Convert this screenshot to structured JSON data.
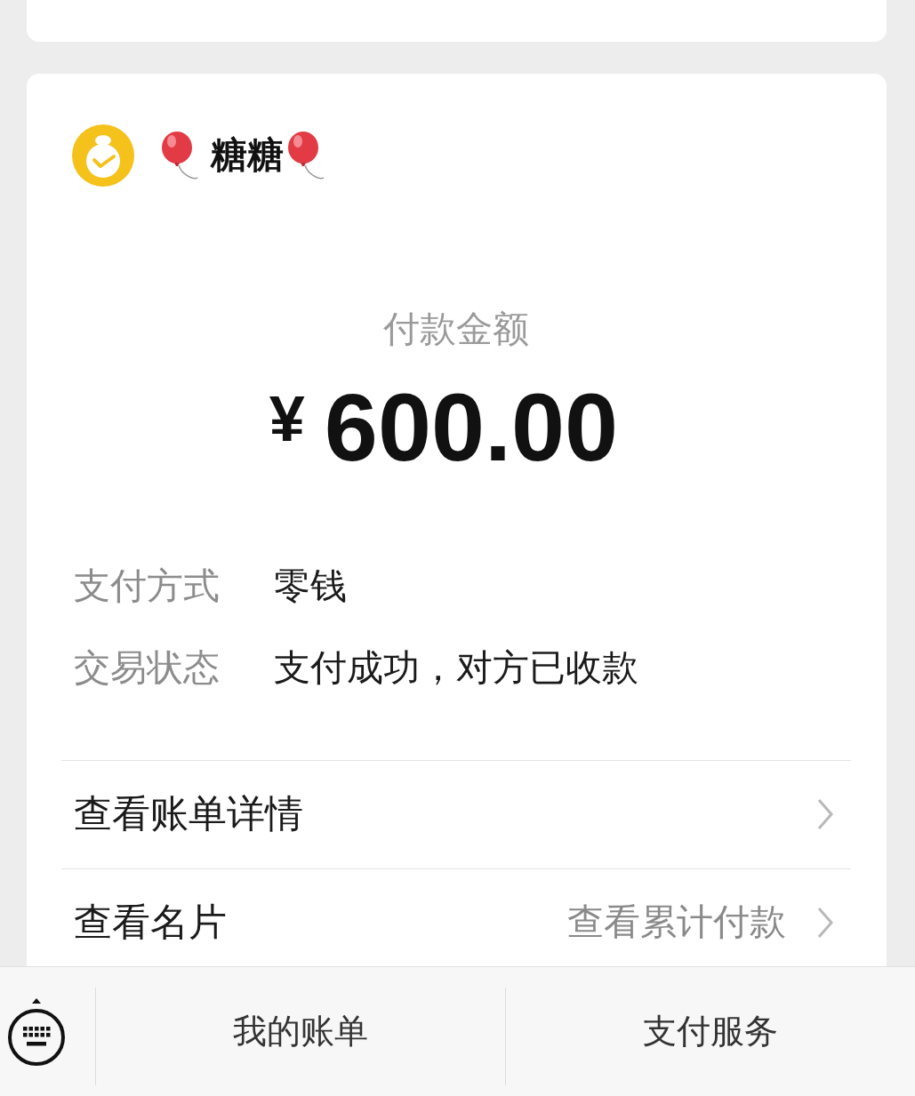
{
  "payee": {
    "name": "糖糖"
  },
  "payment": {
    "label": "付款金额",
    "currency": "¥",
    "amount": "600.00"
  },
  "details": [
    {
      "label": "支付方式",
      "value": "零钱"
    },
    {
      "label": "交易状态",
      "value": "支付成功，对方已收款"
    }
  ],
  "links": [
    {
      "label": "查看账单详情"
    },
    {
      "label": "查看名片",
      "hint": "查看累计付款"
    }
  ],
  "bottom_menu": [
    {
      "label": "我的账单"
    },
    {
      "label": "支付服务"
    }
  ]
}
